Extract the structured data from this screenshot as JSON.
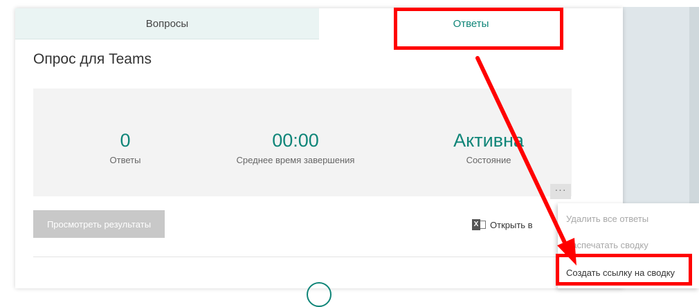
{
  "tabs": {
    "questions": "Вопросы",
    "answers": "Ответы"
  },
  "form": {
    "title": "Опрос для Teams"
  },
  "stats": {
    "responses": {
      "value": "0",
      "label": "Ответы"
    },
    "avg_time": {
      "value": "00:00",
      "label": "Среднее время завершения"
    },
    "status": {
      "value": "Активна",
      "label": "Состояние"
    }
  },
  "more_button": {
    "label": "···",
    "icon": "more-icon"
  },
  "actions": {
    "view_results": "Просмотреть результаты",
    "open_excel": "Открыть в",
    "excel_icon": "excel-icon"
  },
  "dropdown": {
    "delete_all": "Удалить все ответы",
    "print_summary": "Распечатать сводку",
    "create_summary_link": "Создать ссылку на сводку"
  },
  "colors": {
    "accent": "#0f8578",
    "highlight": "#ff0000",
    "tab_inactive_bg": "#eaf4f3",
    "stats_bg": "#f3f3f3",
    "disabled_button": "#c8c8c8"
  }
}
